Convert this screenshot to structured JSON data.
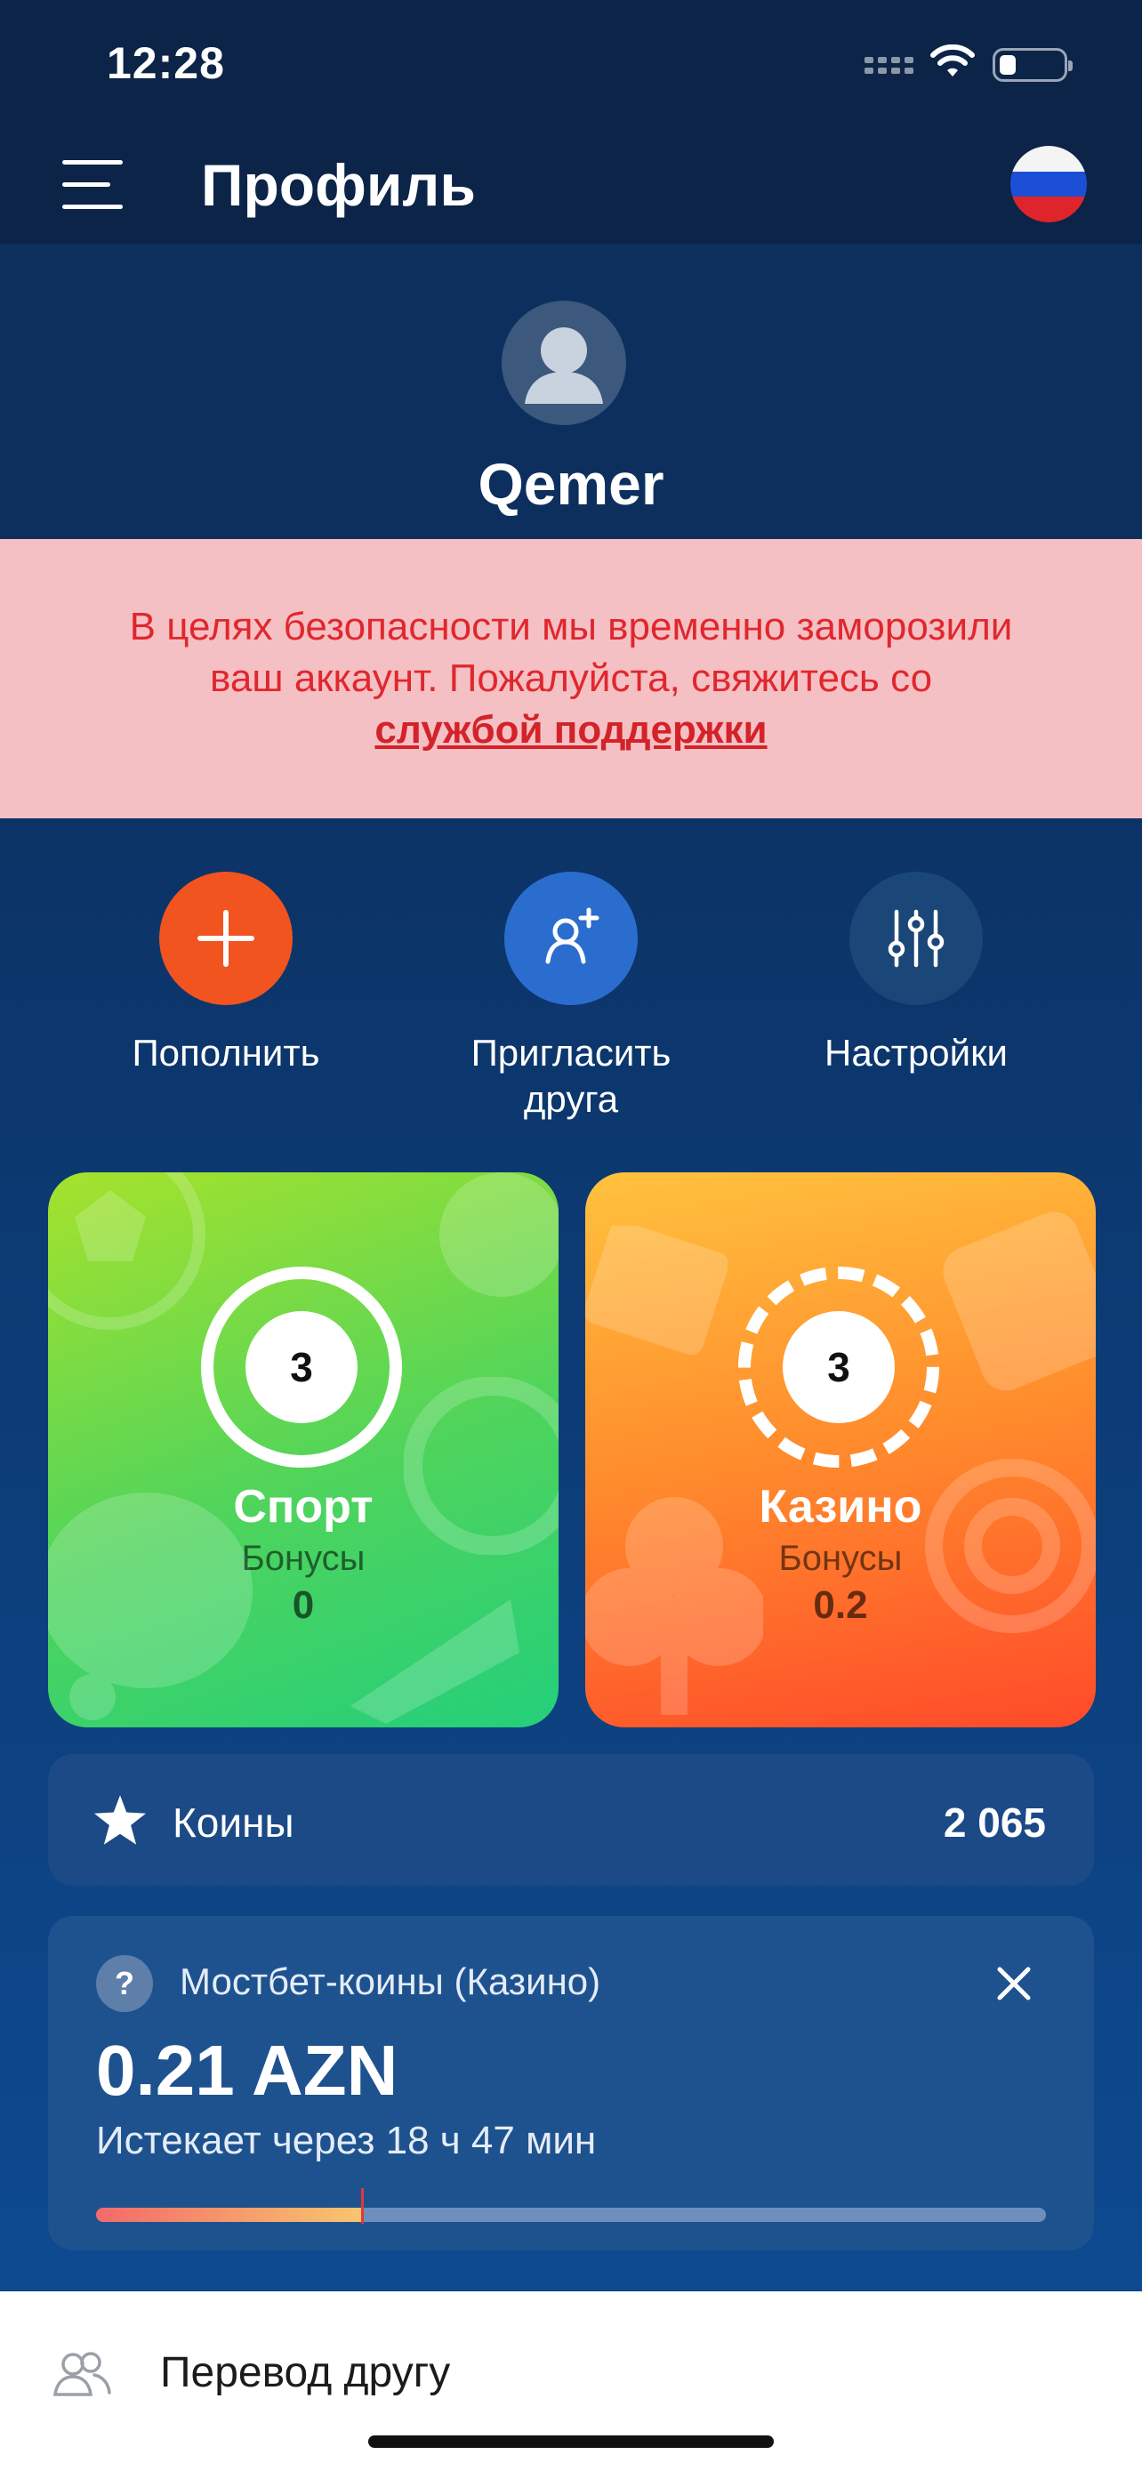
{
  "status": {
    "time": "12:28"
  },
  "header": {
    "title": "Профиль"
  },
  "profile": {
    "username": "Qemer"
  },
  "alert": {
    "line1": "В целях безопасности мы временно заморозили",
    "line2": "ваш аккаунт. Пожалуйста, свяжитесь со",
    "link": "службой поддержки"
  },
  "actions": [
    {
      "label": "Пополнить",
      "icon": "plus-icon",
      "color": "#f1541f"
    },
    {
      "label_line1": "Пригласить",
      "label_line2": "друга",
      "icon": "add-person-icon",
      "color": "#2b6dcf"
    },
    {
      "label": "Настройки",
      "icon": "sliders-icon",
      "color": "#1b4678"
    }
  ],
  "cards": [
    {
      "badge": "3",
      "title": "Спорт",
      "subtitle": "Бонусы",
      "value": "0",
      "icon": "tennis-ball-icon"
    },
    {
      "badge": "3",
      "title": "Казино",
      "subtitle": "Бонусы",
      "value": "0.2",
      "icon": "casino-chip-icon"
    }
  ],
  "coins": {
    "label": "Коины",
    "value": "2 065",
    "icon": "star-icon"
  },
  "promo": {
    "title": "Мостбет-коины (Казино)",
    "amount": "0.21 AZN",
    "expires": "Истекает через 18 ч 47 мин",
    "progress": 0.28,
    "help_icon": "?"
  },
  "bottom": {
    "transfer_label": "Перевод другу",
    "icon": "users-icon"
  },
  "colors": {
    "header": "#0c2447",
    "alert_bg": "#f5c0c3",
    "alert_text": "#e0272e",
    "sport_card": "#3fcf4f",
    "casino_card": "#ff7a2e"
  }
}
